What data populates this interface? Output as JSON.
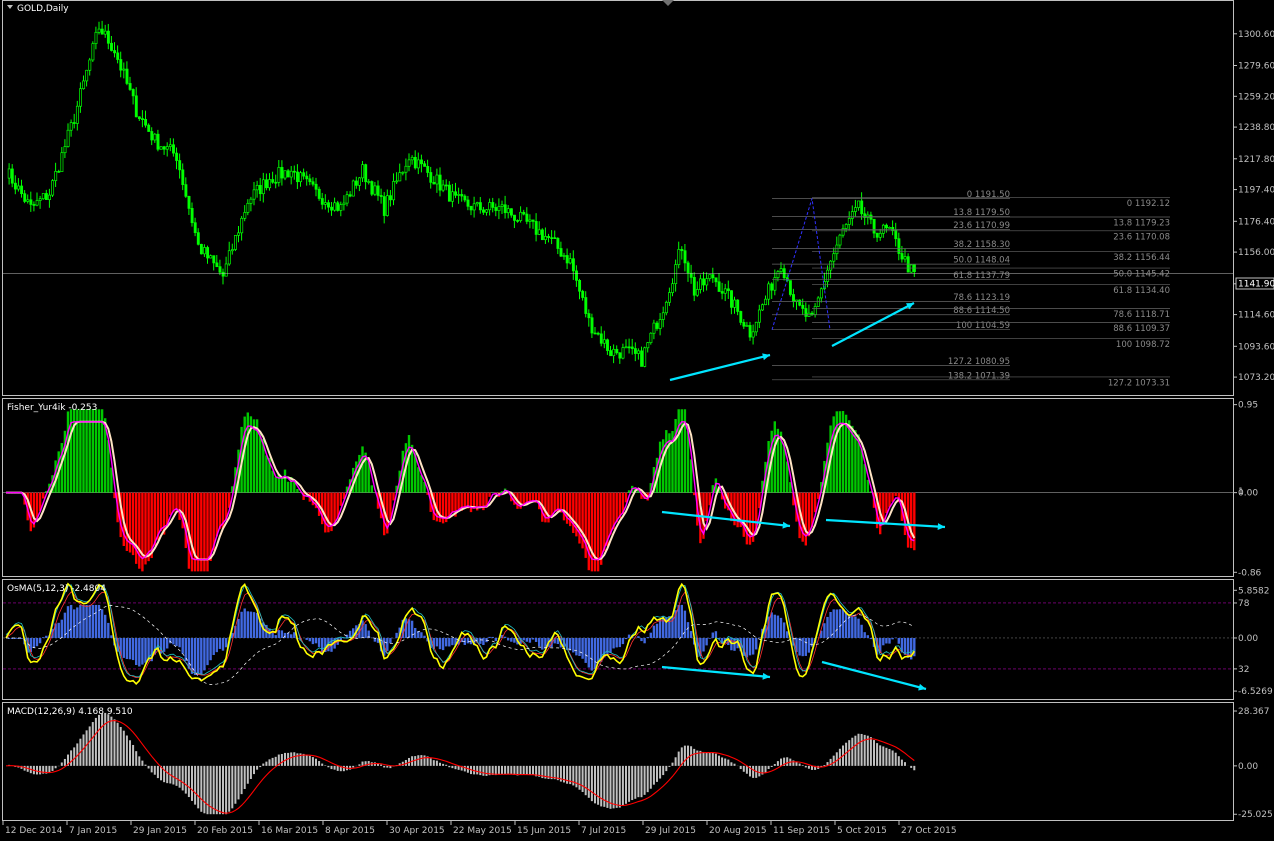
{
  "colors": {
    "background": "#000000",
    "frame": "#c0c0c0",
    "bull_candle": "#00ff00",
    "bear_candle": "#00ff00",
    "fisher_up": "#00c800",
    "fisher_down": "#ff0000",
    "fisher_line": "#ff00ff",
    "fisher_signal": "#ffe4c4",
    "osma_hist": "#4169e1",
    "osma_line": "#ffff00",
    "macd_hist": "#c0c0c0",
    "macd_signal": "#ff0000",
    "arrow": "#00e5ff",
    "fib_line": "#666666",
    "fib_zigzag": "#3030ff"
  },
  "chart_data": [
    {
      "type": "candlestick",
      "title": "GOLD,Daily",
      "ylim": [
        1062,
        1321
      ],
      "y_ticks": [
        "1300.60",
        "1279.60",
        "1259.20",
        "1238.80",
        "1217.80",
        "1197.40",
        "1176.40",
        "1156.00",
        "1135.00",
        "1114.60",
        "1093.60",
        "1073.20"
      ],
      "current_price": "1141.90",
      "close_series_start": 1210,
      "waypoints": [
        [
          0,
          1210
        ],
        [
          8,
          1185
        ],
        [
          14,
          1195
        ],
        [
          22,
          1245
        ],
        [
          30,
          1305
        ],
        [
          35,
          1290
        ],
        [
          42,
          1250
        ],
        [
          48,
          1230
        ],
        [
          55,
          1220
        ],
        [
          62,
          1160
        ],
        [
          70,
          1140
        ],
        [
          78,
          1190
        ],
        [
          85,
          1205
        ],
        [
          92,
          1210
        ],
        [
          100,
          1195
        ],
        [
          108,
          1185
        ],
        [
          115,
          1210
        ],
        [
          122,
          1185
        ],
        [
          130,
          1220
        ],
        [
          138,
          1205
        ],
        [
          145,
          1190
        ],
        [
          152,
          1185
        ],
        [
          160,
          1185
        ],
        [
          168,
          1175
        ],
        [
          175,
          1165
        ],
        [
          182,
          1150
        ],
        [
          188,
          1110
        ],
        [
          195,
          1090
        ],
        [
          200,
          1090
        ],
        [
          205,
          1085
        ],
        [
          212,
          1120
        ],
        [
          218,
          1160
        ],
        [
          222,
          1130
        ],
        [
          228,
          1140
        ],
        [
          235,
          1120
        ],
        [
          240,
          1103
        ],
        [
          245,
          1125
        ],
        [
          250,
          1150
        ],
        [
          255,
          1120
        ],
        [
          260,
          1110
        ],
        [
          265,
          1145
        ],
        [
          270,
          1170
        ],
        [
          275,
          1185
        ],
        [
          280,
          1170
        ],
        [
          285,
          1170
        ],
        [
          290,
          1150
        ],
        [
          293,
          1140
        ]
      ],
      "fib_left": [
        {
          "level": "0",
          "price": "1191.50"
        },
        {
          "level": "13.8",
          "price": "1179.50"
        },
        {
          "level": "23.6",
          "price": "1170.99"
        },
        {
          "level": "38.2",
          "price": "1158.30"
        },
        {
          "level": "50.0",
          "price": "1148.04"
        },
        {
          "level": "61.8",
          "price": "1137.79"
        },
        {
          "level": "78.6",
          "price": "1123.19"
        },
        {
          "level": "88.6",
          "price": "1114.50"
        },
        {
          "level": "100",
          "price": "1104.59"
        },
        {
          "level": "127.2",
          "price": "1080.95"
        },
        {
          "level": "138.2",
          "price": "1071.39"
        }
      ],
      "fib_right": [
        {
          "level": "0",
          "price": "1192.12"
        },
        {
          "level": "13.8",
          "price": "1179.23"
        },
        {
          "level": "23.6",
          "price": "1170.08"
        },
        {
          "level": "38.2",
          "price": "1156.44"
        },
        {
          "level": "50.0",
          "price": "1145.42"
        },
        {
          "level": "61.8",
          "price": "1134.40"
        },
        {
          "level": "78.6",
          "price": "1118.71"
        },
        {
          "level": "88.6",
          "price": "1109.37"
        },
        {
          "level": "100",
          "price": "1098.72"
        },
        {
          "level": "127.2",
          "price": "1073.31"
        }
      ]
    },
    {
      "type": "bar",
      "title": "Fisher_Yur4ik -0.253",
      "ylim": [
        -0.9,
        1.0
      ],
      "y_ticks": [
        "0.95",
        "0.00",
        "-0.86"
      ]
    },
    {
      "type": "bar",
      "title": "OsMA(5,12,3) -2.4804",
      "ylim": [
        -7.5,
        7.0
      ],
      "y_ticks": [
        "5.8582",
        "78",
        "0.00",
        "32",
        "-6.5269"
      ]
    },
    {
      "type": "bar",
      "title": "MACD(12,26,9) 4.168 9.510",
      "ylim": [
        -28,
        32
      ],
      "y_ticks": [
        "28.367",
        "0.00",
        "-25.025"
      ]
    }
  ],
  "x_axis": {
    "dates": [
      "12 Dec 2014",
      "7 Jan 2015",
      "29 Jan 2015",
      "20 Feb 2015",
      "16 Mar 2015",
      "8 Apr 2015",
      "30 Apr 2015",
      "22 May 2015",
      "15 Jun 2015",
      "7 Jul 2015",
      "29 Jul 2015",
      "20 Aug 2015",
      "11 Sep 2015",
      "5 Oct 2015",
      "27 Oct 2015"
    ]
  },
  "side_labels": {
    "fisher_marker": "1"
  }
}
